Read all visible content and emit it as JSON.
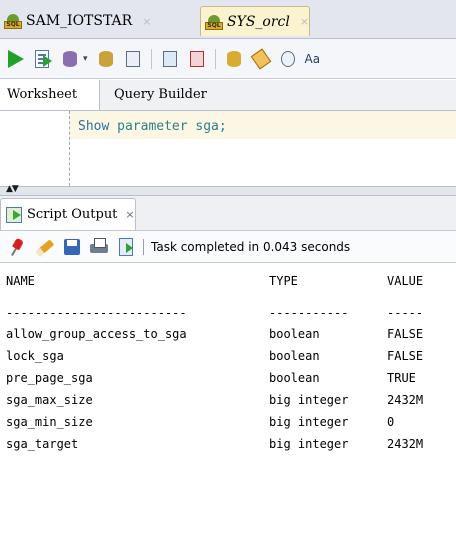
{
  "tabs": [
    {
      "label": "SAM_IOTSTAR",
      "close": "×",
      "active": false
    },
    {
      "label": "SYS_orcl",
      "close": "×",
      "active": true
    }
  ],
  "db_icon_tag": "SQL",
  "worksheet_tabs": {
    "worksheet": "Worksheet",
    "query_builder": "Query Builder"
  },
  "toolbar": {
    "font_button_text": "Aa",
    "dropdown_glyph": "▾"
  },
  "editor": {
    "keyword": "Show",
    "rest": " parameter sga;"
  },
  "splitter": {
    "arrows": "▲▼"
  },
  "output_tab": {
    "label": "Script Output",
    "close": "×"
  },
  "output_toolbar": {
    "status": "Task completed in 0.043 seconds"
  },
  "results": {
    "headers": [
      "NAME",
      "TYPE",
      "VALUE"
    ],
    "separators": [
      "-------------------------",
      "-----------",
      "-----"
    ],
    "rows": [
      [
        "allow_group_access_to_sga",
        "boolean",
        "FALSE"
      ],
      [
        "lock_sga",
        "boolean",
        "FALSE"
      ],
      [
        "pre_page_sga",
        "boolean",
        "TRUE"
      ],
      [
        "sga_max_size",
        "big integer",
        "2432M"
      ],
      [
        "sga_min_size",
        "big integer",
        "0"
      ],
      [
        "sga_target",
        "big integer",
        "2432M"
      ]
    ]
  },
  "colors": {
    "accent_tab": "#fbf3cf",
    "code": "#2d7d8e",
    "run": "#22a02c"
  }
}
